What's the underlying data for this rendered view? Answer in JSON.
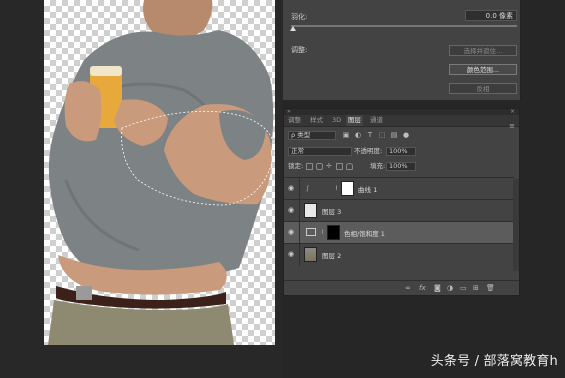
{
  "properties": {
    "feather_label": "羽化:",
    "feather_value": "0.0 像素",
    "adjust_label": "调整:",
    "btn_select_mask": "选择并遮住...",
    "btn_color_range": "颜色范围...",
    "btn_invert": "反相"
  },
  "layers_panel": {
    "tabs": [
      "调整",
      "样式",
      "3D",
      "图层",
      "通道"
    ],
    "active_tab": "图层",
    "filter_label": "ρ 类型",
    "blend_mode": "正常",
    "opacity_label": "不透明度:",
    "opacity_value": "100%",
    "lock_label": "锁定:",
    "fill_label": "填充:",
    "fill_value": "100%",
    "layers": [
      {
        "name": "曲线 1",
        "kind": "curves-adjustment",
        "selected": false
      },
      {
        "name": "图层 3",
        "kind": "pixel",
        "selected": false
      },
      {
        "name": "色相/饱和度 1",
        "kind": "hue-saturation-adjustment",
        "selected": true
      },
      {
        "name": "图层 2",
        "kind": "pixel",
        "selected": false
      }
    ],
    "footer_icons": [
      "link-icon",
      "fx-icon",
      "mask-icon",
      "adjustment-icon",
      "folder-icon",
      "new-layer-icon",
      "trash-icon"
    ]
  },
  "watermark": "头条号 / 部落窝教育h",
  "colors": {
    "panel_bg": "#434343",
    "selected_layer": "#5c5c5c",
    "shirt": "#7d8384",
    "skin": "#c99a7c",
    "pants": "#8e8a72"
  }
}
